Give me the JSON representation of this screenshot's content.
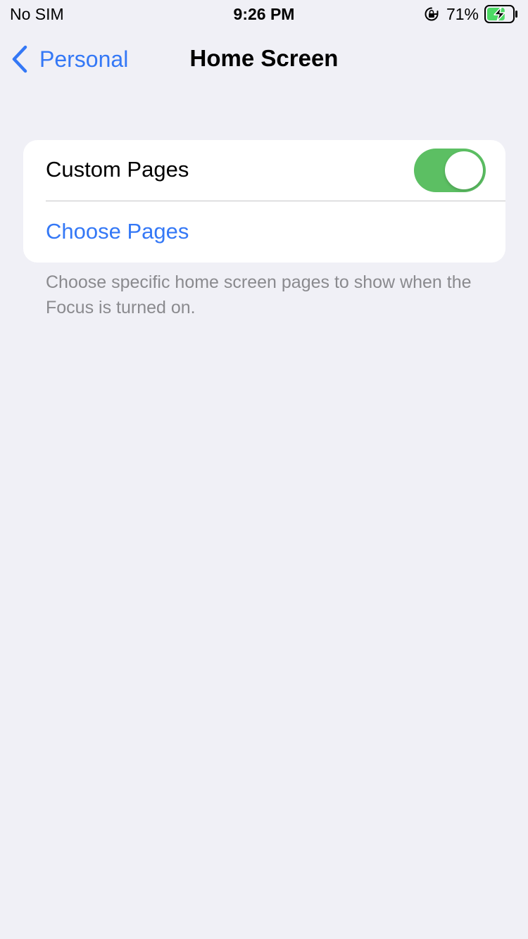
{
  "status_bar": {
    "carrier": "No SIM",
    "time": "9:26 PM",
    "battery_percent": "71%",
    "battery_level": 0.71,
    "icons": [
      "orientation-lock-icon",
      "battery-charging-icon"
    ]
  },
  "nav": {
    "back_label": "Personal",
    "title": "Home Screen",
    "back_icon": "chevron-left-icon"
  },
  "settings": {
    "custom_pages": {
      "label": "Custom Pages",
      "toggle_on": true
    },
    "choose_pages_label": "Choose Pages"
  },
  "footer": {
    "text": "Choose specific home screen pages to show when the Focus is turned on."
  },
  "colors": {
    "accent": "#3478f6",
    "toggle_on": "#5cbf63",
    "background": "#f0f0f6",
    "battery_fill": "#4cd964"
  }
}
